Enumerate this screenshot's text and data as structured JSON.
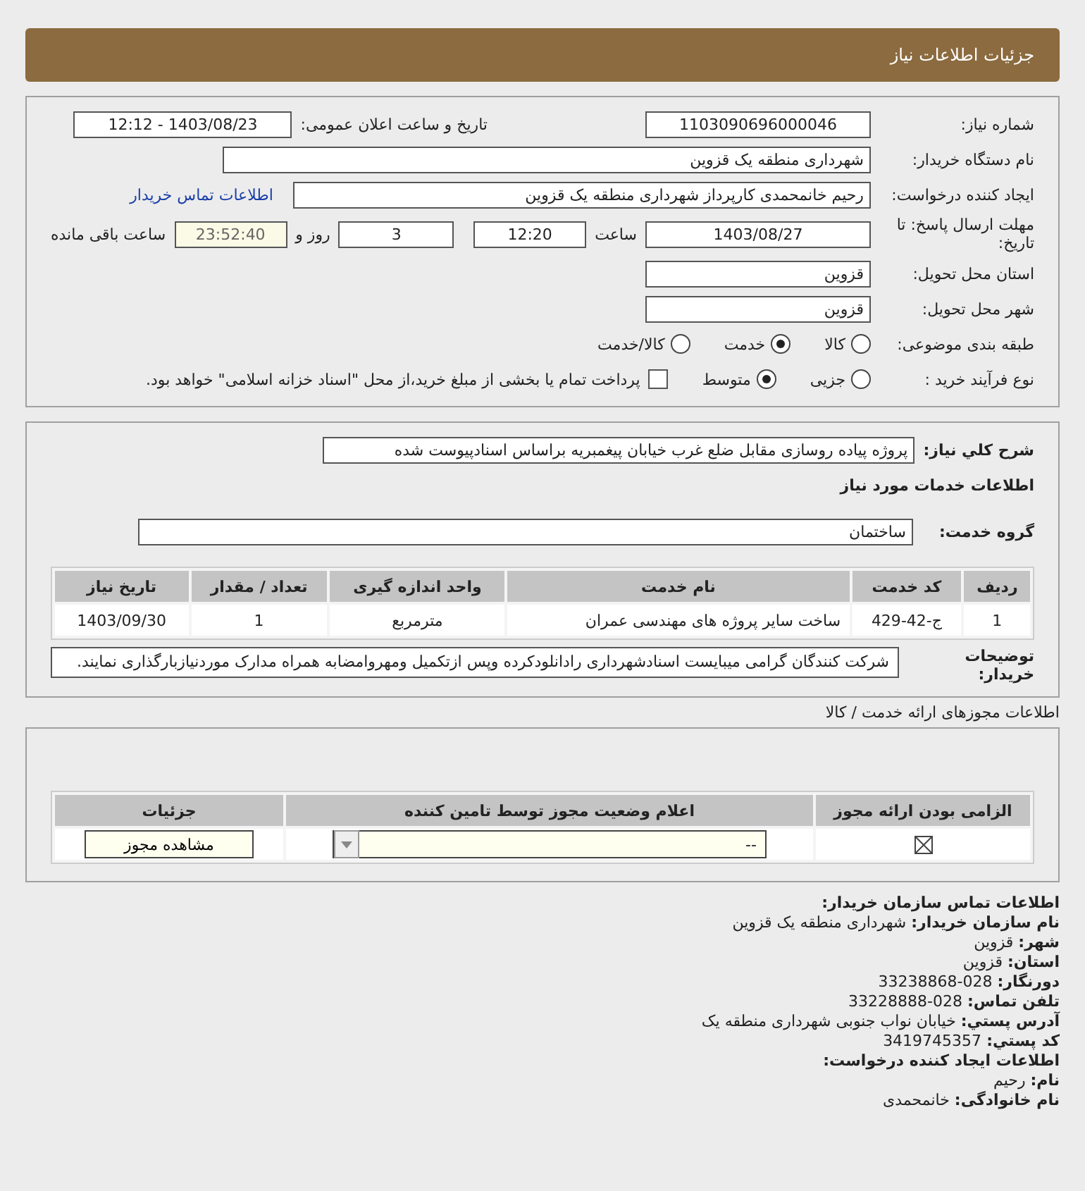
{
  "header": {
    "title": "جزئیات اطلاعات نیاز"
  },
  "need": {
    "number": {
      "label": "شماره نیاز:",
      "value": "1103090696000046"
    },
    "announce": {
      "label": "تاریخ و ساعت اعلان عمومی:",
      "value": "1403/08/23 - 12:12"
    },
    "buyer": {
      "label": "نام دستگاه خریدار:",
      "value": "شهرداری منطقه یک قزوین"
    },
    "creator": {
      "label": "ایجاد کننده درخواست:",
      "value": "رحیم خانمحمدی کارپرداز شهرداری منطقه یک قزوین",
      "link": "اطلاعات تماس خریدار"
    },
    "deadline": {
      "label": "مهلت ارسال پاسخ: تا تاریخ:",
      "date": "1403/08/27",
      "time_label": "ساعت",
      "time": "12:20",
      "days": "3",
      "days_label": "روز و",
      "remaining": "23:52:40",
      "remaining_label": "ساعت باقی مانده"
    },
    "province": {
      "label": "استان محل تحویل:",
      "value": "قزوین"
    },
    "city": {
      "label": "شهر محل تحویل:",
      "value": "قزوین"
    },
    "category": {
      "label": "طبقه بندی موضوعی:",
      "options": [
        {
          "label": "کالا",
          "selected": false
        },
        {
          "label": "خدمت",
          "selected": true
        },
        {
          "label": "کالا/خدمت",
          "selected": false
        }
      ]
    },
    "process": {
      "label": "نوع فرآیند خرید :",
      "options": [
        {
          "label": "جزیی",
          "selected": false
        },
        {
          "label": "متوسط",
          "selected": true
        }
      ],
      "payment": {
        "label": "پرداخت تمام یا بخشی از مبلغ خرید،از محل \"اسناد خزانه اسلامی\" خواهد بود.",
        "checked": false
      }
    }
  },
  "services": {
    "description": {
      "label": "شرح کلي نياز:",
      "value": "پروژه پیاده روسازی مقابل ضلع غرب خیابان پیغمبریه براساس اسنادپیوست شده"
    },
    "title": "اطلاعات خدمات مورد نیاز",
    "group": {
      "label": "گروه خدمت:",
      "value": "ساختمان"
    },
    "table": {
      "columns": [
        "ردیف",
        "کد خدمت",
        "نام خدمت",
        "واحد اندازه گیری",
        "تعداد / مقدار",
        "تاریخ نیاز"
      ],
      "rows": [
        [
          "1",
          "ج-42-429",
          "ساخت سایر پروژه های مهندسی عمران",
          "مترمربع",
          "1",
          "1403/09/30"
        ]
      ]
    },
    "notes": {
      "label": "توضیحات خریدار:",
      "value": "شرکت کنندگان گرامی میبایست اسنادشهرداری رادانلودکرده وپس ازتکمیل ومهروامضابه همراه مدارک موردنیازبارگذاری نمایند."
    }
  },
  "permits": {
    "title": "اطلاعات مجوزهای ارائه خدمت / کالا",
    "columns": [
      "الزامی بودن ارائه مجوز",
      "اعلام وضعیت مجوز توسط تامین کننده",
      "جزئیات"
    ],
    "rows": [
      {
        "required": true,
        "status": "--",
        "button": "مشاهده مجوز"
      }
    ]
  },
  "contact": [
    {
      "kind": "title",
      "text": "اطلاعات تماس سازمان خریدار:"
    },
    {
      "kind": "line",
      "label": "نام سازمان خریدار:",
      "value": "شهرداری منطقه یک قزوین"
    },
    {
      "kind": "line",
      "label": "شهر:",
      "value": "قزوین"
    },
    {
      "kind": "line",
      "label": "استان:",
      "value": "قزوین"
    },
    {
      "kind": "line",
      "label": "دورنگار:",
      "value": "028-33238868"
    },
    {
      "kind": "line",
      "label": "تلفن تماس:",
      "value": "028-33228888"
    },
    {
      "kind": "line",
      "label": "آدرس پستي:",
      "value": "خیابان نواب جنوبی شهرداری منطقه یک"
    },
    {
      "kind": "line",
      "label": "کد پستي:",
      "value": "3419745357"
    },
    {
      "kind": "title",
      "text": "اطلاعات ایجاد کننده درخواست:"
    },
    {
      "kind": "line",
      "label": "نام:",
      "value": "رحیم"
    },
    {
      "kind": "line",
      "label": "نام خانوادگی:",
      "value": "خانمحمدی"
    }
  ]
}
